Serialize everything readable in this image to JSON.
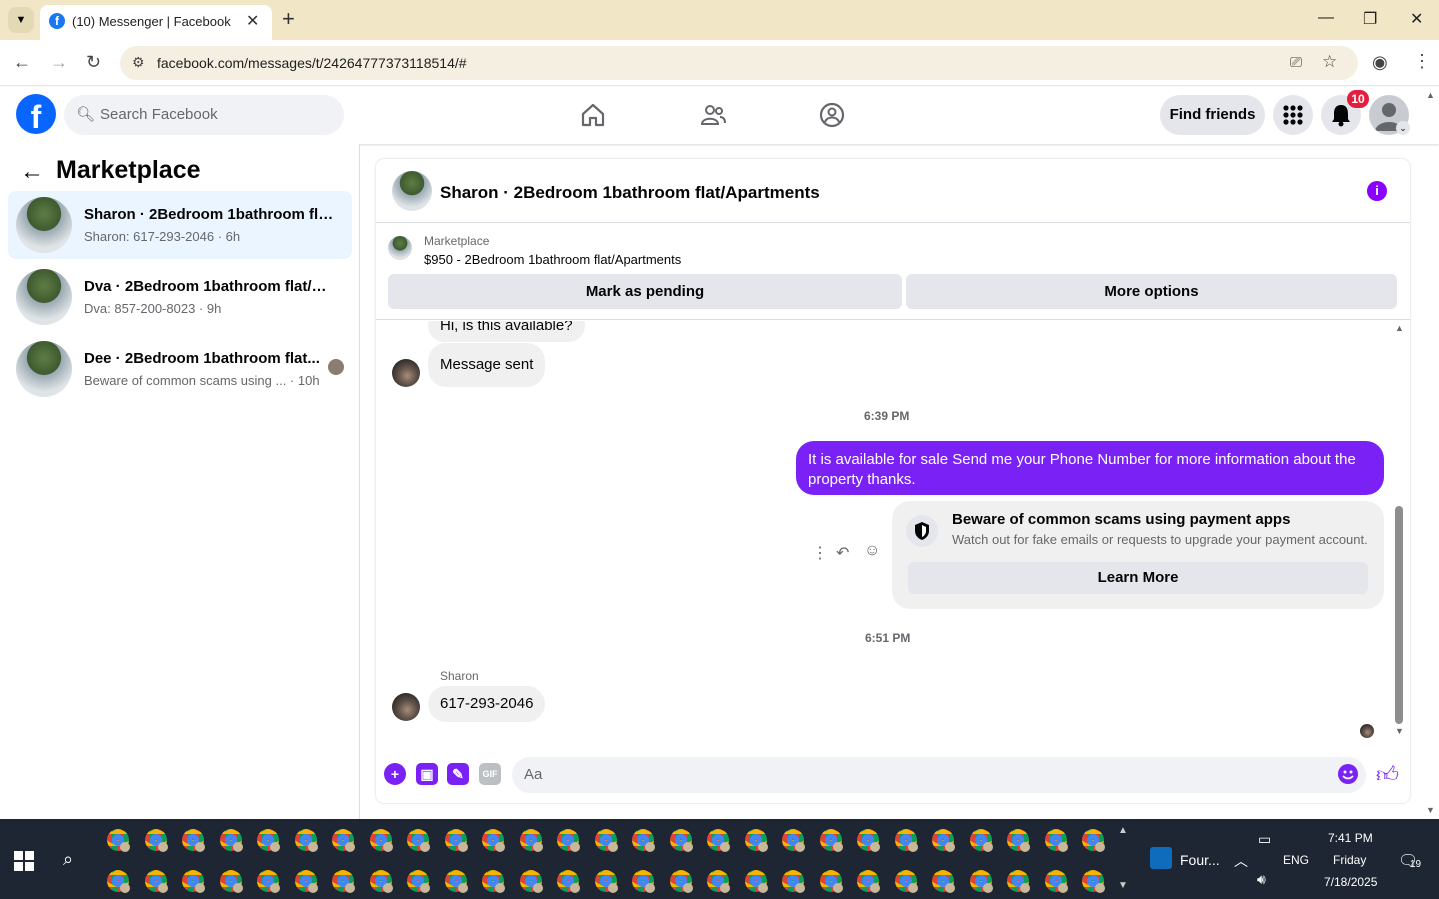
{
  "browser": {
    "tab_title": "(10) Messenger | Facebook",
    "url": "facebook.com/messages/t/24264777373118514/#"
  },
  "facebook": {
    "search_placeholder": "Search Facebook",
    "find_friends": "Find friends",
    "notification_count": "10"
  },
  "left_panel": {
    "title": "Marketplace",
    "conversations": [
      {
        "name": "Sharon · 2Bedroom 1bathroom flat...",
        "preview": "Sharon: 617-293-2046 · 6h",
        "active": true
      },
      {
        "name": "Dva · 2Bedroom 1bathroom flat/A...",
        "preview": "Dva: 857-200-8023 · 9h",
        "active": false
      },
      {
        "name": "Dee · 2Bedroom 1bathroom flat...",
        "preview": "Beware of common scams using ...  · 10h",
        "active": false
      }
    ]
  },
  "chat": {
    "title": "Sharon · 2Bedroom 1bathroom flat/Apartments",
    "listing_source": "Marketplace",
    "listing_price": "$950 - 2Bedroom 1bathroom flat/Apartments",
    "mark_pending": "Mark as pending",
    "more_options": "More options",
    "messages": {
      "partial": "Hi, is this available?",
      "sent_notice": "Message sent",
      "time1": "6:39 PM",
      "outgoing": "It is available for sale Send me your Phone Number for more information about the property thanks.",
      "scam_title": "Beware of common scams using payment apps",
      "scam_sub": "Watch out for fake emails or requests to upgrade your payment account.",
      "learn_more": "Learn More",
      "time2": "6:51 PM",
      "sender": "Sharon",
      "incoming_phone": "617-293-2046"
    },
    "composer_placeholder": "Aa"
  },
  "taskbar": {
    "outlook_label": "Four...",
    "language": "ENG",
    "time": "7:41 PM",
    "day": "Friday",
    "date": "7/18/2025",
    "notification_count": "19"
  },
  "colors": {
    "accent": "#7a21f5",
    "fb_blue": "#0866ff",
    "badge_red": "#e41e3f"
  }
}
